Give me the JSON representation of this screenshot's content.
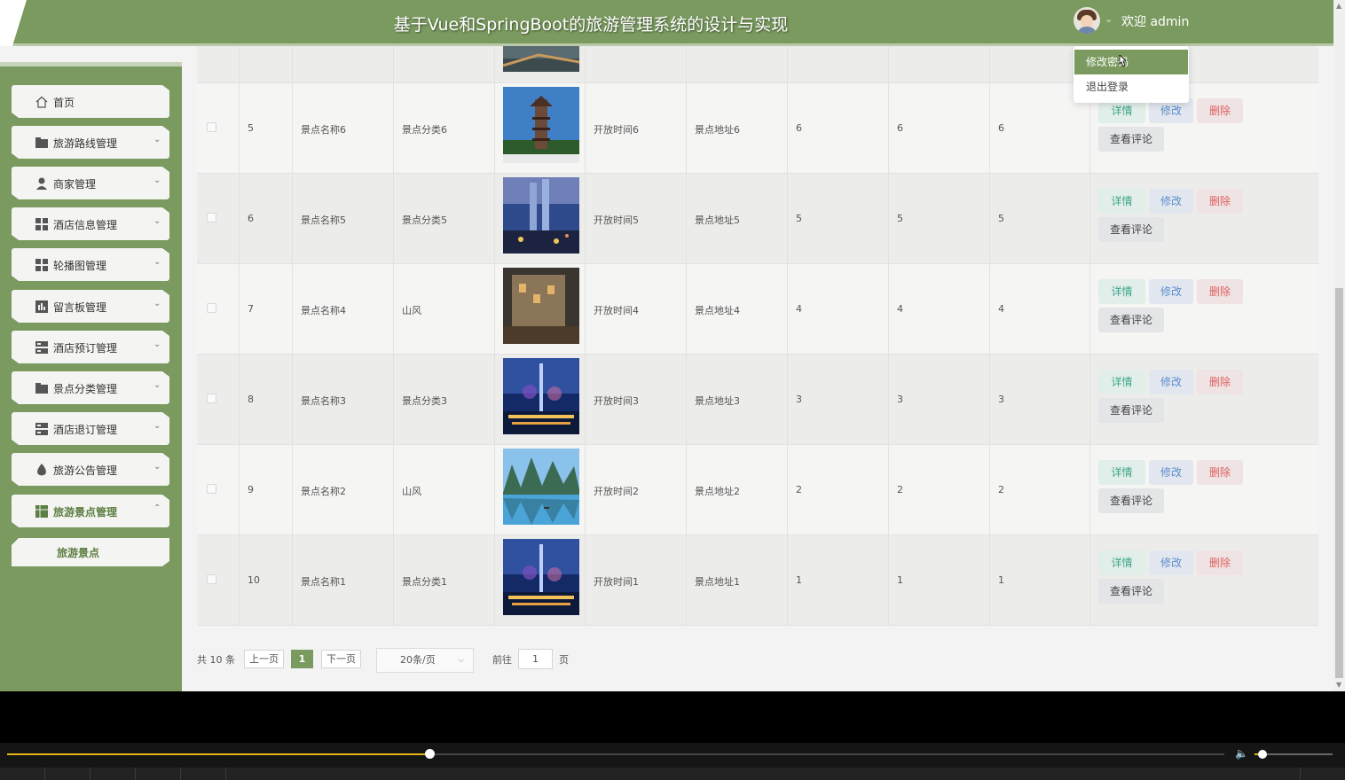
{
  "header": {
    "title": "基于Vue和SpringBoot的旅游管理系统的设计与实现",
    "welcome": "欢迎 admin",
    "brand_color": "#7a9a5f"
  },
  "user_menu": {
    "items": [
      {
        "label": "修改密码",
        "icon": ""
      },
      {
        "label": "退出登录",
        "icon": ""
      }
    ]
  },
  "sidebar": {
    "items": [
      {
        "label": "首页",
        "icon": "home-icon",
        "active": false,
        "expandable": false
      },
      {
        "label": "旅游路线管理",
        "icon": "folder-icon",
        "expandable": true
      },
      {
        "label": "商家管理",
        "icon": "user-icon",
        "expandable": true
      },
      {
        "label": "酒店信息管理",
        "icon": "grid-icon",
        "expandable": true
      },
      {
        "label": "轮播图管理",
        "icon": "grid-icon",
        "expandable": true
      },
      {
        "label": "留言板管理",
        "icon": "chart-icon",
        "expandable": true
      },
      {
        "label": "酒店预订管理",
        "icon": "server-icon",
        "expandable": true
      },
      {
        "label": "景点分类管理",
        "icon": "folder-icon",
        "expandable": true
      },
      {
        "label": "酒店退订管理",
        "icon": "server-icon",
        "expandable": true
      },
      {
        "label": "旅游公告管理",
        "icon": "drop-icon",
        "expandable": true
      },
      {
        "label": "旅游景点管理",
        "icon": "table-icon",
        "expandable": true,
        "active": true
      }
    ],
    "sub_item": "旅游景点"
  },
  "table": {
    "rows": [
      {
        "index": "5",
        "name": "景点名称6",
        "category": "景点分类6",
        "image": "pagoda-image",
        "open_time": "开放时间6",
        "address": "景点地址6",
        "c1": "6",
        "c2": "6",
        "c3": "6"
      },
      {
        "index": "6",
        "name": "景点名称5",
        "category": "景点分类5",
        "image": "skyline-night-image",
        "open_time": "开放时间5",
        "address": "景点地址5",
        "c1": "5",
        "c2": "5",
        "c3": "5"
      },
      {
        "index": "7",
        "name": "景点名称4",
        "category": "山风",
        "image": "old-town-image",
        "open_time": "开放时间4",
        "address": "景点地址4",
        "c1": "4",
        "c2": "4",
        "c3": "4"
      },
      {
        "index": "8",
        "name": "景点名称3",
        "category": "景点分类3",
        "image": "tower-night-image",
        "open_time": "开放时间3",
        "address": "景点地址3",
        "c1": "3",
        "c2": "3",
        "c3": "3"
      },
      {
        "index": "9",
        "name": "景点名称2",
        "category": "山风",
        "image": "karst-river-image",
        "open_time": "开放时间2",
        "address": "景点地址2",
        "c1": "2",
        "c2": "2",
        "c3": "2"
      },
      {
        "index": "10",
        "name": "景点名称1",
        "category": "景点分类1",
        "image": "tower-night-image",
        "open_time": "开放时间1",
        "address": "景点地址1",
        "c1": "1",
        "c2": "1",
        "c3": "1"
      }
    ],
    "actions": {
      "detail": "详情",
      "edit": "修改",
      "delete": "删除",
      "review": "查看评论"
    }
  },
  "pagination": {
    "total": "共 10 条",
    "prev": "上一页",
    "current": "1",
    "next": "下一页",
    "page_size": "20条/页",
    "goto_label": "前往",
    "goto_value": "1",
    "page_suffix": "页"
  },
  "video_player": {
    "progress": 0.347,
    "volume": 0.1
  }
}
